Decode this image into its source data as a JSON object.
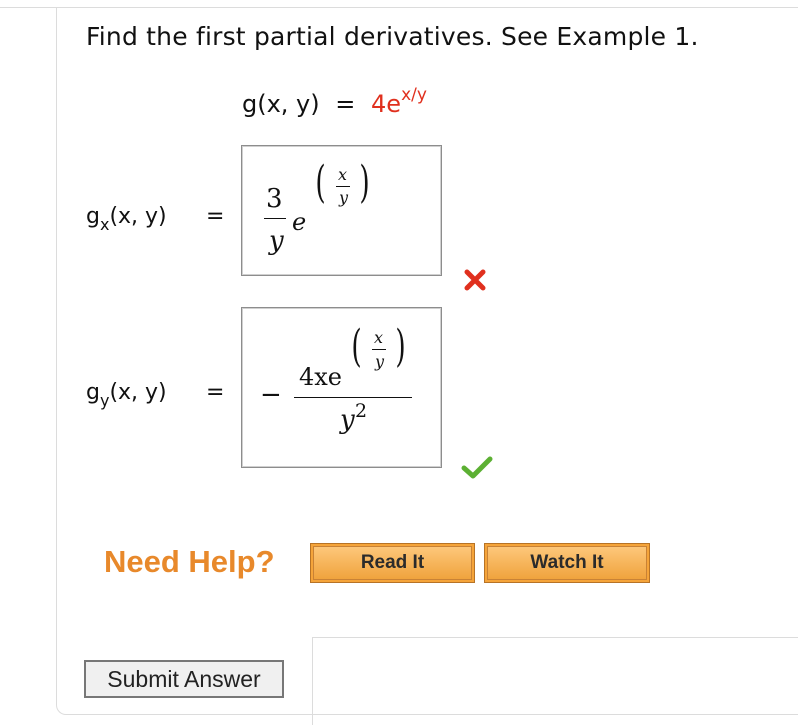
{
  "question": {
    "text": "Find the first partial derivatives. See Example 1."
  },
  "function": {
    "lhs": "g(x, y)",
    "equals": "=",
    "coeff": "4e",
    "exponent": "x/y"
  },
  "answers": [
    {
      "lhs": "g",
      "lhs_sub": "x",
      "lhs_args": "(x, y)",
      "equals": "=",
      "numerator": "3",
      "denominator": "y",
      "base": "e",
      "exp_num": "x",
      "exp_den": "y",
      "lparen": "(",
      "rparen": ")",
      "status": "incorrect",
      "status_color": "#e0301e"
    },
    {
      "lhs": "g",
      "lhs_sub": "y",
      "lhs_args": "(x, y)",
      "equals": "=",
      "sign": "−",
      "num_text": "4xe",
      "exp_num": "x",
      "exp_den": "y",
      "lparen": "(",
      "rparen": ")",
      "den_base": "y",
      "den_exp": "2",
      "status": "correct",
      "status_color": "#5cb033"
    }
  ],
  "help": {
    "label": "Need Help?",
    "read_it": "Read It",
    "watch_it": "Watch It",
    "accent": "#e8892b"
  },
  "submit": {
    "label": "Submit Answer"
  }
}
